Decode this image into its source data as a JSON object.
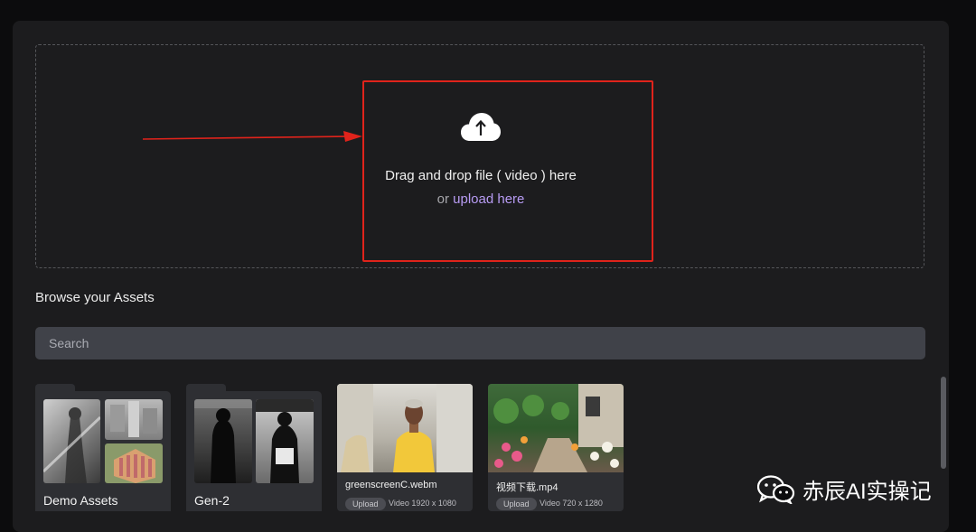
{
  "upload": {
    "title": "Drag and drop file ( video ) here",
    "or_text": "or",
    "link_text": "upload here"
  },
  "browse": {
    "title": "Browse your Assets",
    "search_placeholder": "Search"
  },
  "folders": [
    {
      "label": "Demo Assets"
    },
    {
      "label": "Gen-2"
    }
  ],
  "assets": [
    {
      "name": "greenscreenC.webm",
      "tag": "Upload",
      "meta": "Video 1920 x 1080"
    },
    {
      "name": "视频下载.mp4",
      "tag": "Upload",
      "meta": "Video 720 x 1280"
    }
  ],
  "annotation": {
    "color": "#e0231b"
  },
  "accent": {
    "link": "#b79bf3"
  },
  "icons": [
    "upload-cloud-icon",
    "wechat-icon"
  ],
  "watermark": {
    "text": "赤辰AI实操记"
  }
}
